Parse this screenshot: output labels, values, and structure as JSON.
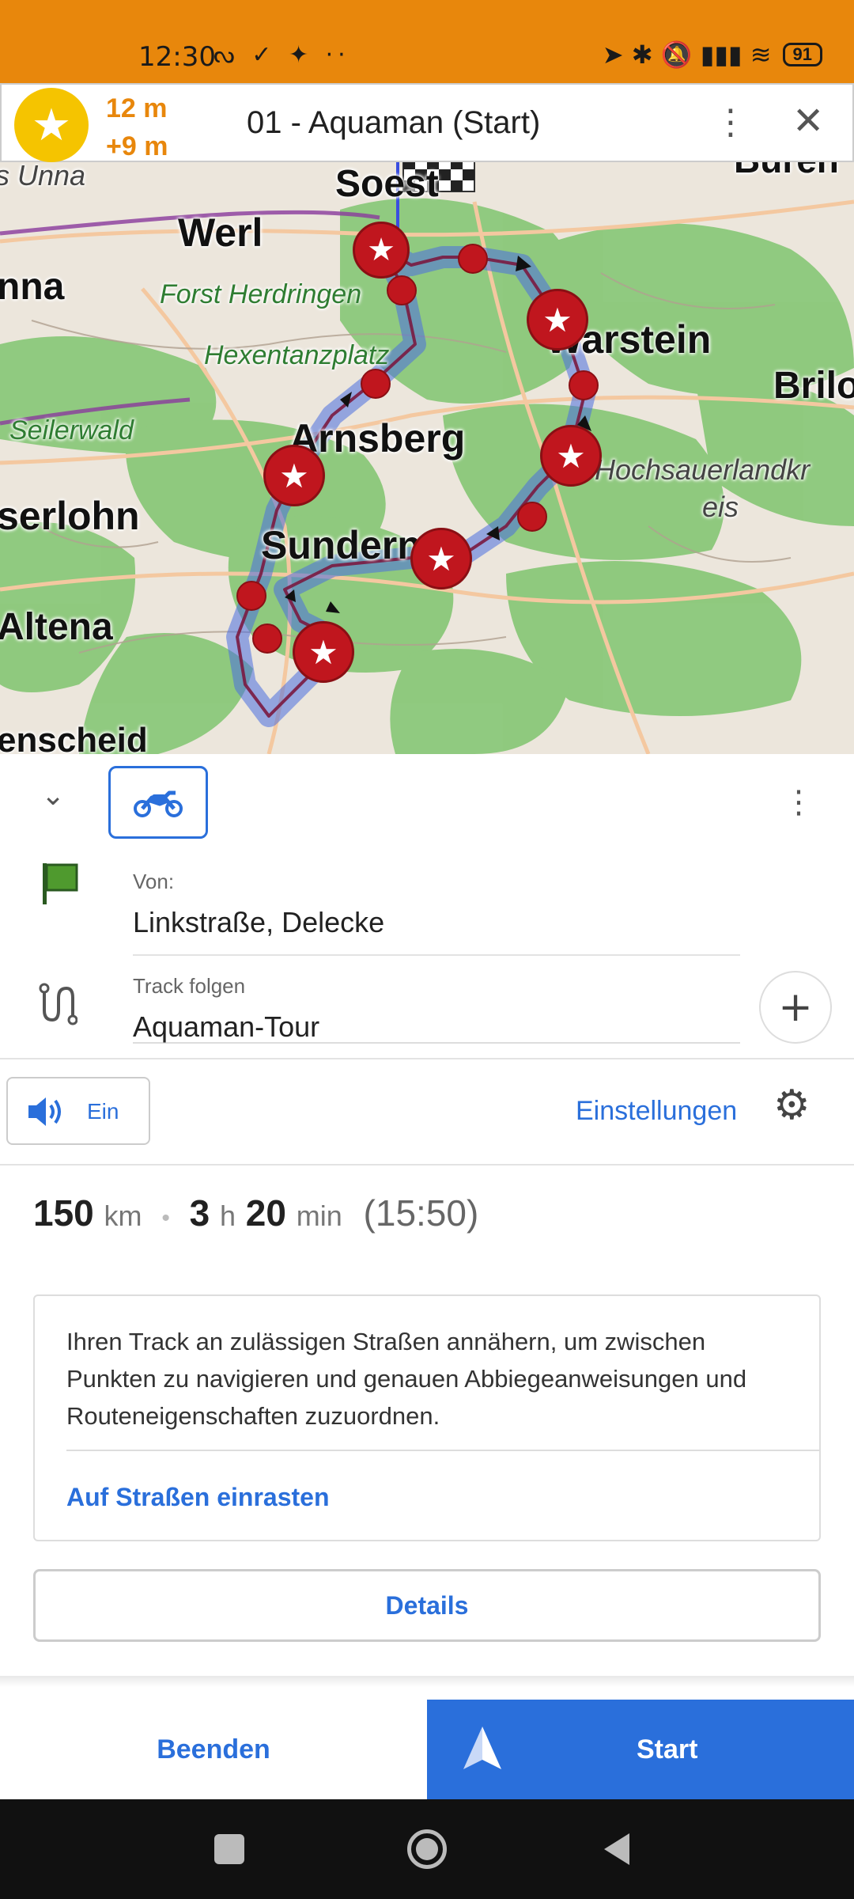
{
  "status_bar": {
    "time": "12:30",
    "left_icons": "ᔓ ✓ ✦ ··",
    "right_icons": "➤ ✱ 🔕 ▮▮▮ ≋",
    "battery": "91"
  },
  "nav_card": {
    "distance_1": "12 m",
    "distance_2": "+9 m",
    "title": "01 - Aquaman (Start)",
    "badge_icon": "star-icon"
  },
  "map": {
    "labels": {
      "soest": "Soest",
      "werl": "Werl",
      "unna_top": "s Unna",
      "unna": "nna",
      "buren": "Büren",
      "forst": "Forst Herdringen",
      "hexen": "Hexentanzplatz",
      "warstein": "Warstein",
      "brilon": "Brilo",
      "seilerwald": "Seilerwald",
      "arnsberg": "Arnsberg",
      "iserlohn": "serlohn",
      "hochsauerland_1": "Hochsauerlandkr",
      "hochsauerland_2": "eis",
      "sundern": "Sundern",
      "altena": "Altena",
      "luedenscheid": "enscheid"
    }
  },
  "panel": {
    "from_label": "Von:",
    "from_value": "Linkstraße, Delecke",
    "track_label": "Track folgen",
    "track_value": "Aquaman-Tour",
    "sound_label": "Ein",
    "settings_label": "Einstellungen",
    "summary": {
      "distance": "150",
      "distance_unit": "km",
      "hours": "3",
      "hours_unit": "h",
      "minutes": "20",
      "minutes_unit": "min",
      "eta": "(15:50)"
    },
    "info_text": "Ihren Track an zulässigen Straßen annähern, um zwischen Punkten zu navigieren und genauen Abbiegeanweisungen und Routeneigenschaften zuzuordnen.",
    "snap_link": "Auf Straßen einrasten",
    "details_button": "Details"
  },
  "actions": {
    "end_label": "Beenden",
    "start_label": "Start"
  },
  "colors": {
    "status_bar": "#E8870C",
    "accent": "#2A6FDB",
    "badge": "#F5C400",
    "waypoint": "#C0161E",
    "forest": "#8BC87A"
  }
}
